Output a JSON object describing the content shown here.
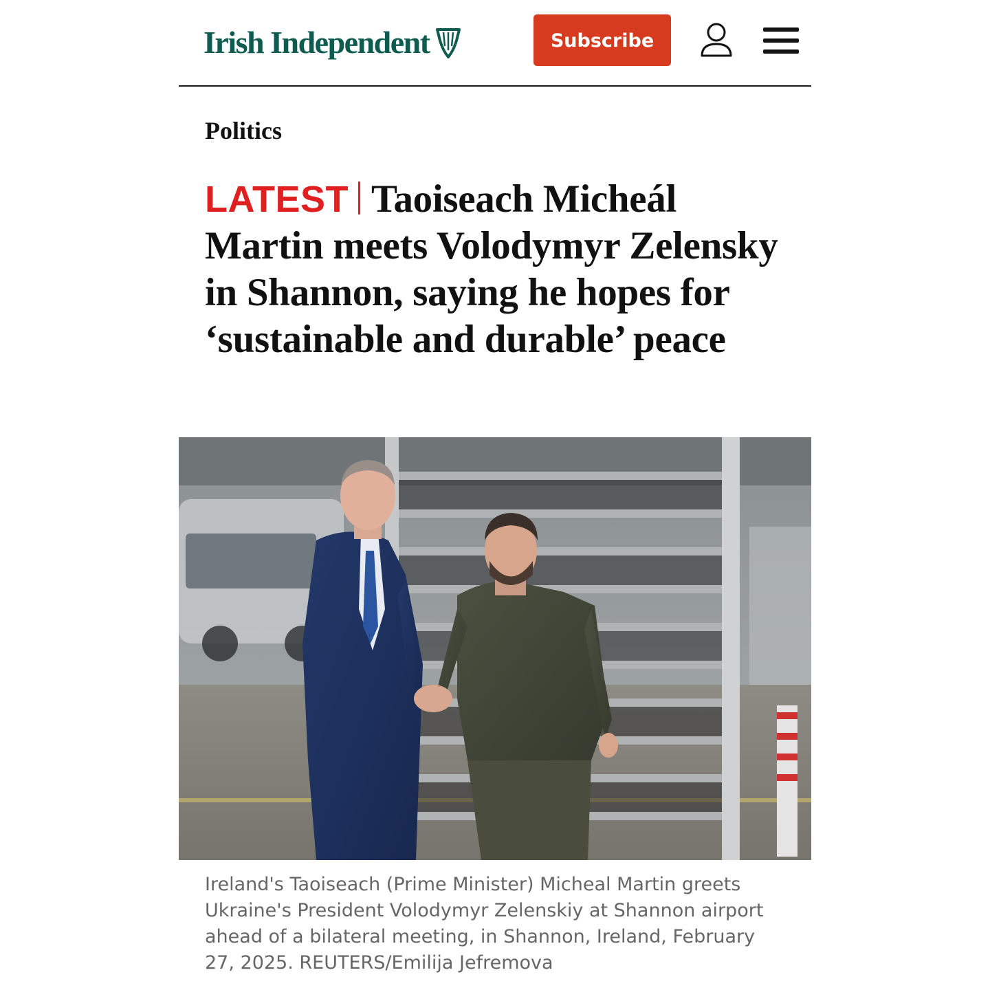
{
  "header": {
    "logo_text": "Irish Independent",
    "subscribe_label": "Subscribe",
    "brand_color": "#0d5c4f",
    "accent_color": "#d63a1f",
    "icons": [
      "harp-icon",
      "account-icon",
      "menu-icon"
    ]
  },
  "article": {
    "section": "Politics",
    "tag": "LATEST",
    "headline": "Taoiseach Micheál Martin meets Volodymyr Zelensky in Shannon, saying he hopes for ‘sustainable and durable’ peace",
    "caption": "Ireland's Taoiseach (Prime Minister) Micheal Martin greets Ukraine's President Volodymyr Zelenskiy at Shannon airport ahead of a bilateral meeting, in Shannon, Ireland, February 27, 2025. REUTERS/Emilija Jefremova",
    "tag_color": "#e02020"
  }
}
